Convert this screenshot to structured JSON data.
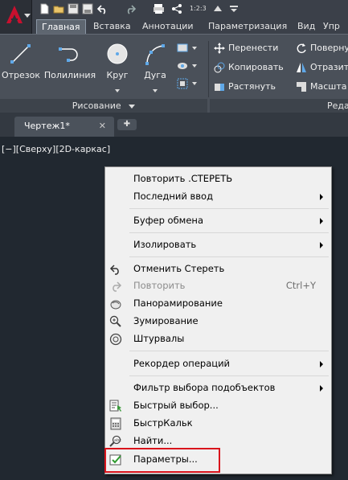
{
  "ribbon": {
    "tabs": [
      "Главная",
      "Вставка",
      "Аннотации",
      "Параметризация",
      "Вид",
      "Упр"
    ],
    "draw_tools": [
      {
        "label": "Отрезок",
        "icon": "line-icon"
      },
      {
        "label": "Полилиния",
        "icon": "polyline-icon"
      },
      {
        "label": "Круг",
        "icon": "circle-icon"
      },
      {
        "label": "Дуга",
        "icon": "arc-icon"
      }
    ],
    "modify_tools": [
      {
        "label": "Перенести",
        "icon": "move-icon"
      },
      {
        "label": "Копировать",
        "icon": "copy-icon"
      },
      {
        "label": "Растянуть",
        "icon": "stretch-icon"
      }
    ],
    "modify_tools_right": [
      {
        "label": "Поверну",
        "icon": "rotate-icon"
      },
      {
        "label": "Отразит",
        "icon": "mirror-icon"
      },
      {
        "label": "Масшта",
        "icon": "scale-icon"
      }
    ],
    "panel_draw_title": "Рисование",
    "panel_modify_title": "Реда"
  },
  "document": {
    "tab_title": "Чертеж1*",
    "view_label": "[−][Сверху][2D-каркас]"
  },
  "context_menu": {
    "items": [
      {
        "label": "Повторить .СТЕРЕТЬ"
      },
      {
        "label": "Последний ввод",
        "submenu": true
      },
      {
        "label": "Буфер обмена",
        "submenu": true
      },
      {
        "label": "Изолировать",
        "submenu": true
      },
      {
        "label": "Отменить Стереть",
        "icon": "undo-icon"
      },
      {
        "label": "Повторить",
        "shortcut": "Ctrl+Y",
        "disabled": true,
        "icon": "redo-icon"
      },
      {
        "label": "Панорамирование",
        "icon": "pan-icon"
      },
      {
        "label": "Зумирование",
        "icon": "zoom-icon"
      },
      {
        "label": "Штурвалы",
        "icon": "steering-wheel-icon"
      },
      {
        "label": "Рекордер операций",
        "submenu": true
      },
      {
        "label": "Фильтр выбора подобъектов",
        "submenu": true
      },
      {
        "label": "Быстрый выбор...",
        "icon": "quick-select-icon"
      },
      {
        "label": "БыстрКальк",
        "icon": "calculator-icon"
      },
      {
        "label": "Найти...",
        "icon": "find-icon"
      },
      {
        "label": "Параметры...",
        "icon": "options-check-icon"
      }
    ]
  },
  "qat": {
    "workspace_label": "1:2:3"
  },
  "colors": {
    "highlight": "#d9141c",
    "accent": "#c8102e"
  }
}
